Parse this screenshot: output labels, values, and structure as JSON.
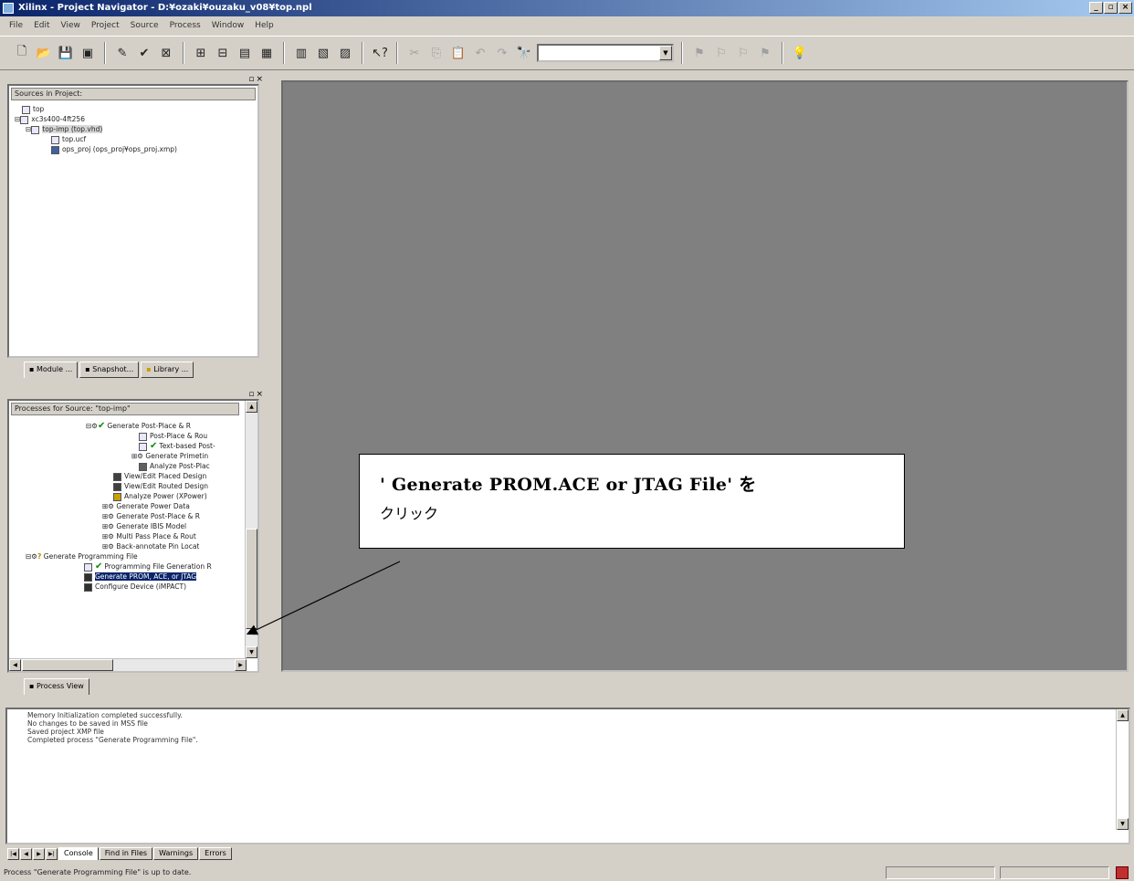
{
  "window": {
    "title": "Xilinx - Project Navigator - D:¥ozaki¥ouzaku_v08¥top.npl"
  },
  "menu": [
    "File",
    "Edit",
    "View",
    "Project",
    "Source",
    "Process",
    "Window",
    "Help"
  ],
  "sources": {
    "header": "Sources in Project:",
    "items": [
      "top",
      "xc3s400-4ft256",
      "top-imp (top.vhd)",
      "top.ucf",
      "ops_proj (ops_proj¥ops_proj.xmp)"
    ],
    "tabs": [
      "Module ...",
      "Snapshot...",
      "Library ..."
    ]
  },
  "processes": {
    "header": "Processes for Source: \"top-imp\"",
    "items": [
      "Generate Post-Place & R",
      "Post-Place & Rou",
      "Text-based Post-",
      "Generate Primetin",
      "Analyze Post-Plac",
      "View/Edit Placed Design",
      "View/Edit Routed Design",
      "Analyze Power (XPower)",
      "Generate Power Data",
      "Generate Post-Place & R",
      "Generate IBIS Model",
      "Multi Pass Place & Rout",
      "Back-annotate Pin Locat",
      "Generate Programming File",
      "Programming File Generation R",
      "Generate PROM, ACE, or JTAG",
      "Configure Device (iMPACT)"
    ],
    "tab": "Process View"
  },
  "callout": {
    "line1": "' Generate PROM.ACE or JTAG File' を",
    "line2": "クリック"
  },
  "console": {
    "lines": [
      "Memory Initialization completed successfully.",
      "",
      "No changes to be saved in MSS file",
      "Saved project XMP file",
      "Completed process \"Generate Programming File\"."
    ],
    "tabs": [
      "Console",
      "Find in Files",
      "Warnings",
      "Errors"
    ]
  },
  "status": {
    "text": "Process \"Generate Programming File\" is up to date."
  }
}
